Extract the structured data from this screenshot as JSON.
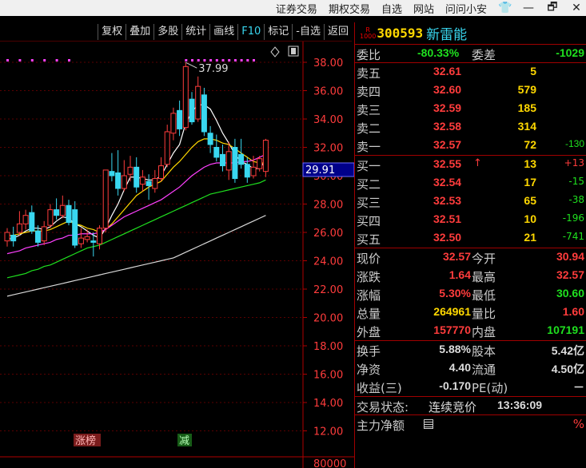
{
  "titlebar": {
    "menus": [
      "证券交易",
      "期权交易",
      "自选",
      "网站",
      "问问小安"
    ],
    "window_icons": [
      "shirt-icon",
      "minimize-icon",
      "restore-icon",
      "close-icon"
    ],
    "window_glyphs": [
      "👕",
      "—",
      "🗗",
      "✕"
    ]
  },
  "toolbar": {
    "buttons": [
      "复权",
      "叠加",
      "多股",
      "统计",
      "画线",
      "F10",
      "标记",
      "-自选",
      "返回"
    ]
  },
  "chart_data": {
    "type": "candlestick",
    "yaxis": {
      "ticks": [
        "38.00",
        "36.00",
        "34.00",
        "32.00",
        "30.00",
        "28.00",
        "26.00",
        "24.00",
        "22.00",
        "20.00",
        "18.00",
        "16.00",
        "14.00",
        "12.00"
      ],
      "range": [
        11.0,
        39.0
      ],
      "volume_tick": "80000"
    },
    "current_price_tag": "29.91",
    "max_annotation": "37.99",
    "markers": [
      "涨榜",
      "减"
    ],
    "candles": [
      {
        "o": 25.4,
        "c": 26.0,
        "h": 26.3,
        "l": 25.0
      },
      {
        "o": 25.8,
        "c": 25.4,
        "h": 26.4,
        "l": 25.0
      },
      {
        "o": 26.0,
        "c": 26.6,
        "h": 27.5,
        "l": 25.8
      },
      {
        "o": 26.6,
        "c": 27.2,
        "h": 27.6,
        "l": 26.2
      },
      {
        "o": 27.4,
        "c": 26.1,
        "h": 27.9,
        "l": 25.9
      },
      {
        "o": 26.1,
        "c": 25.3,
        "h": 26.5,
        "l": 25.0
      },
      {
        "o": 25.4,
        "c": 26.4,
        "h": 26.8,
        "l": 25.1
      },
      {
        "o": 26.5,
        "c": 27.6,
        "h": 28.0,
        "l": 26.3
      },
      {
        "o": 27.6,
        "c": 27.2,
        "h": 28.4,
        "l": 26.9
      },
      {
        "o": 27.2,
        "c": 27.9,
        "h": 28.6,
        "l": 27.0
      },
      {
        "o": 27.9,
        "c": 26.7,
        "h": 28.3,
        "l": 26.5
      },
      {
        "o": 27.6,
        "c": 25.1,
        "h": 28.2,
        "l": 24.9
      },
      {
        "o": 25.2,
        "c": 25.6,
        "h": 26.3,
        "l": 24.9
      },
      {
        "o": 25.5,
        "c": 25.7,
        "h": 26.2,
        "l": 25.3
      },
      {
        "o": 25.4,
        "c": 25.3,
        "h": 26.0,
        "l": 24.3
      },
      {
        "o": 25.2,
        "c": 26.3,
        "h": 26.5,
        "l": 24.8
      },
      {
        "o": 26.3,
        "c": 30.4,
        "h": 30.4,
        "l": 26.0
      },
      {
        "o": 30.3,
        "c": 30.0,
        "h": 31.6,
        "l": 29.6
      },
      {
        "o": 30.2,
        "c": 29.1,
        "h": 31.8,
        "l": 28.6
      },
      {
        "o": 29.1,
        "c": 30.0,
        "h": 31.1,
        "l": 28.9
      },
      {
        "o": 30.1,
        "c": 30.6,
        "h": 31.4,
        "l": 29.6
      },
      {
        "o": 30.6,
        "c": 29.2,
        "h": 31.3,
        "l": 28.8
      },
      {
        "o": 29.4,
        "c": 29.9,
        "h": 30.4,
        "l": 28.9
      },
      {
        "o": 29.6,
        "c": 29.3,
        "h": 30.1,
        "l": 28.3
      },
      {
        "o": 29.1,
        "c": 29.8,
        "h": 30.4,
        "l": 28.8
      },
      {
        "o": 29.8,
        "c": 30.7,
        "h": 31.3,
        "l": 29.6
      },
      {
        "o": 30.8,
        "c": 33.1,
        "h": 33.6,
        "l": 30.6
      },
      {
        "o": 33.0,
        "c": 34.4,
        "h": 34.8,
        "l": 32.5
      },
      {
        "o": 34.6,
        "c": 33.3,
        "h": 35.3,
        "l": 32.8
      },
      {
        "o": 33.4,
        "c": 37.7,
        "h": 37.99,
        "l": 33.2
      },
      {
        "o": 35.4,
        "c": 33.8,
        "h": 35.9,
        "l": 33.6
      },
      {
        "o": 34.0,
        "c": 36.3,
        "h": 37.0,
        "l": 33.8
      },
      {
        "o": 35.7,
        "c": 33.1,
        "h": 36.2,
        "l": 32.8
      },
      {
        "o": 33.0,
        "c": 32.2,
        "h": 33.5,
        "l": 31.6
      },
      {
        "o": 32.0,
        "c": 31.3,
        "h": 32.9,
        "l": 31.0
      },
      {
        "o": 31.5,
        "c": 30.7,
        "h": 32.2,
        "l": 30.3
      },
      {
        "o": 30.4,
        "c": 31.7,
        "h": 32.4,
        "l": 29.7
      },
      {
        "o": 32.0,
        "c": 29.8,
        "h": 32.6,
        "l": 29.5
      },
      {
        "o": 31.5,
        "c": 30.8,
        "h": 32.6,
        "l": 30.5
      },
      {
        "o": 30.8,
        "c": 29.9,
        "h": 31.3,
        "l": 29.5
      },
      {
        "o": 30.0,
        "c": 30.6,
        "h": 31.4,
        "l": 29.8
      },
      {
        "o": 30.5,
        "c": 31.2,
        "h": 31.4,
        "l": 30.3
      },
      {
        "o": 30.3,
        "c": 32.5,
        "h": 32.6,
        "l": 29.9
      }
    ],
    "ma_series": [
      {
        "color": "#ffffff",
        "values": [
          25.5,
          25.6,
          25.8,
          26.1,
          26.3,
          26.3,
          26.2,
          26.4,
          26.8,
          27.1,
          27.0,
          26.6,
          26.4,
          26.1,
          25.8,
          25.6,
          26.3,
          27.2,
          28.0,
          29.0,
          29.9,
          29.9,
          29.8,
          29.7,
          29.7,
          30.0,
          30.8,
          31.6,
          32.2,
          33.7,
          34.5,
          35.0,
          35.0,
          34.7,
          33.9,
          33.0,
          32.3,
          31.5,
          31.0,
          30.8,
          30.5,
          30.5,
          31.1
        ]
      },
      {
        "color": "#ffd800",
        "values": [
          25.8,
          25.8,
          25.9,
          26.0,
          26.1,
          26.1,
          26.1,
          26.2,
          26.4,
          26.6,
          26.8,
          26.6,
          26.5,
          26.3,
          26.2,
          26.0,
          26.2,
          26.6,
          27.1,
          27.6,
          28.1,
          28.6,
          28.9,
          29.2,
          29.4,
          29.6,
          30.1,
          30.6,
          31.0,
          31.5,
          32.0,
          32.4,
          32.6,
          32.6,
          32.5,
          32.3,
          32.2,
          31.9,
          31.6,
          31.3,
          31.0,
          30.9,
          30.9
        ]
      },
      {
        "color": "#ff40ff",
        "values": [
          24.5,
          24.6,
          24.7,
          24.9,
          25.0,
          25.1,
          25.2,
          25.3,
          25.5,
          25.6,
          25.8,
          25.8,
          25.9,
          25.9,
          25.9,
          26.0,
          26.2,
          26.5,
          26.8,
          27.1,
          27.3,
          27.5,
          27.7,
          27.9,
          28.1,
          28.3,
          28.6,
          28.9,
          29.2,
          29.6,
          30.0,
          30.3,
          30.6,
          30.8,
          30.9,
          30.9,
          30.9,
          30.9,
          31.0,
          31.0,
          31.1,
          31.3,
          31.5
        ]
      },
      {
        "color": "#1fe01f",
        "values": [
          22.8,
          22.9,
          23.0,
          23.1,
          23.3,
          23.4,
          23.6,
          23.7,
          23.9,
          24.1,
          24.3,
          24.5,
          24.7,
          24.9,
          25.0,
          25.1,
          25.3,
          25.5,
          25.7,
          25.9,
          26.1,
          26.3,
          26.5,
          26.7,
          26.9,
          27.1,
          27.3,
          27.5,
          27.7,
          27.9,
          28.1,
          28.3,
          28.5,
          28.7,
          28.8,
          28.9,
          29.0,
          29.1,
          29.2,
          29.3,
          29.4,
          29.5,
          29.7
        ]
      },
      {
        "color": "#d8d8d8",
        "values": [
          21.5,
          21.6,
          21.7,
          21.8,
          21.9,
          22.0,
          22.1,
          22.2,
          22.3,
          22.4,
          22.5,
          22.6,
          22.7,
          22.8,
          22.9,
          23.0,
          23.1,
          23.2,
          23.3,
          23.4,
          23.5,
          23.6,
          23.7,
          23.8,
          23.9,
          24.0,
          24.1,
          24.2,
          24.4,
          24.6,
          24.8,
          25.0,
          25.2,
          25.4,
          25.6,
          25.8,
          26.0,
          26.2,
          26.4,
          26.6,
          26.8,
          27.0,
          27.2
        ]
      }
    ],
    "dot_rows": [
      {
        "from": 0,
        "to": 10,
        "step": 2
      },
      {
        "from": 29,
        "to": 40,
        "step": 3
      }
    ]
  },
  "quote": {
    "badge_top": "R",
    "badge_bottom": "1000",
    "code": "300593",
    "name": "新雷能",
    "webi": {
      "label": "委比",
      "value": "-80.33%",
      "label2": "委差",
      "value2": "-1029"
    },
    "asks": [
      {
        "label": "卖五",
        "price": "32.61",
        "vol": "5",
        "chg": ""
      },
      {
        "label": "卖四",
        "price": "32.60",
        "vol": "579",
        "chg": ""
      },
      {
        "label": "卖三",
        "price": "32.59",
        "vol": "185",
        "chg": ""
      },
      {
        "label": "卖二",
        "price": "32.58",
        "vol": "314",
        "chg": ""
      },
      {
        "label": "卖一",
        "price": "32.57",
        "vol": "72",
        "chg": "-130"
      }
    ],
    "bids": [
      {
        "label": "买一",
        "price": "32.55",
        "arrow": "↑",
        "vol": "13",
        "chg": "+13"
      },
      {
        "label": "买二",
        "price": "32.54",
        "arrow": "",
        "vol": "17",
        "chg": "-15"
      },
      {
        "label": "买三",
        "price": "32.53",
        "arrow": "",
        "vol": "65",
        "chg": "-38"
      },
      {
        "label": "买四",
        "price": "32.51",
        "arrow": "",
        "vol": "10",
        "chg": "-196"
      },
      {
        "label": "买五",
        "price": "32.50",
        "arrow": "",
        "vol": "21",
        "chg": "-741"
      }
    ],
    "stats": [
      {
        "l1": "现价",
        "v1": "32.57",
        "c1": "red",
        "l2": "今开",
        "v2": "30.94",
        "c2": "red"
      },
      {
        "l1": "涨跌",
        "v1": "1.64",
        "c1": "red",
        "l2": "最高",
        "v2": "32.57",
        "c2": "red"
      },
      {
        "l1": "涨幅",
        "v1": "5.30%",
        "c1": "red",
        "l2": "最低",
        "v2": "30.60",
        "c2": "green"
      },
      {
        "l1": "总量",
        "v1": "264961",
        "c1": "yel",
        "l2": "量比",
        "v2": "1.60",
        "c2": "red"
      },
      {
        "l1": "外盘",
        "v1": "157770",
        "c1": "red",
        "l2": "内盘",
        "v2": "107191",
        "c2": "green"
      }
    ],
    "stats2": [
      {
        "l1": "换手",
        "v1": "5.88%",
        "l2": "股本",
        "v2": "5.42亿"
      },
      {
        "l1": "净资",
        "v1": "4.40",
        "l2": "流通",
        "v2": "4.50亿"
      },
      {
        "l1": "收益(三)",
        "v1": "-0.170",
        "l2": "PE(动)",
        "v2": "－"
      }
    ],
    "status": {
      "label": "交易状态:",
      "value": "连续竞价",
      "time": "13:36:09"
    },
    "main_net": {
      "label": "主力净额",
      "suffix": "%"
    }
  }
}
